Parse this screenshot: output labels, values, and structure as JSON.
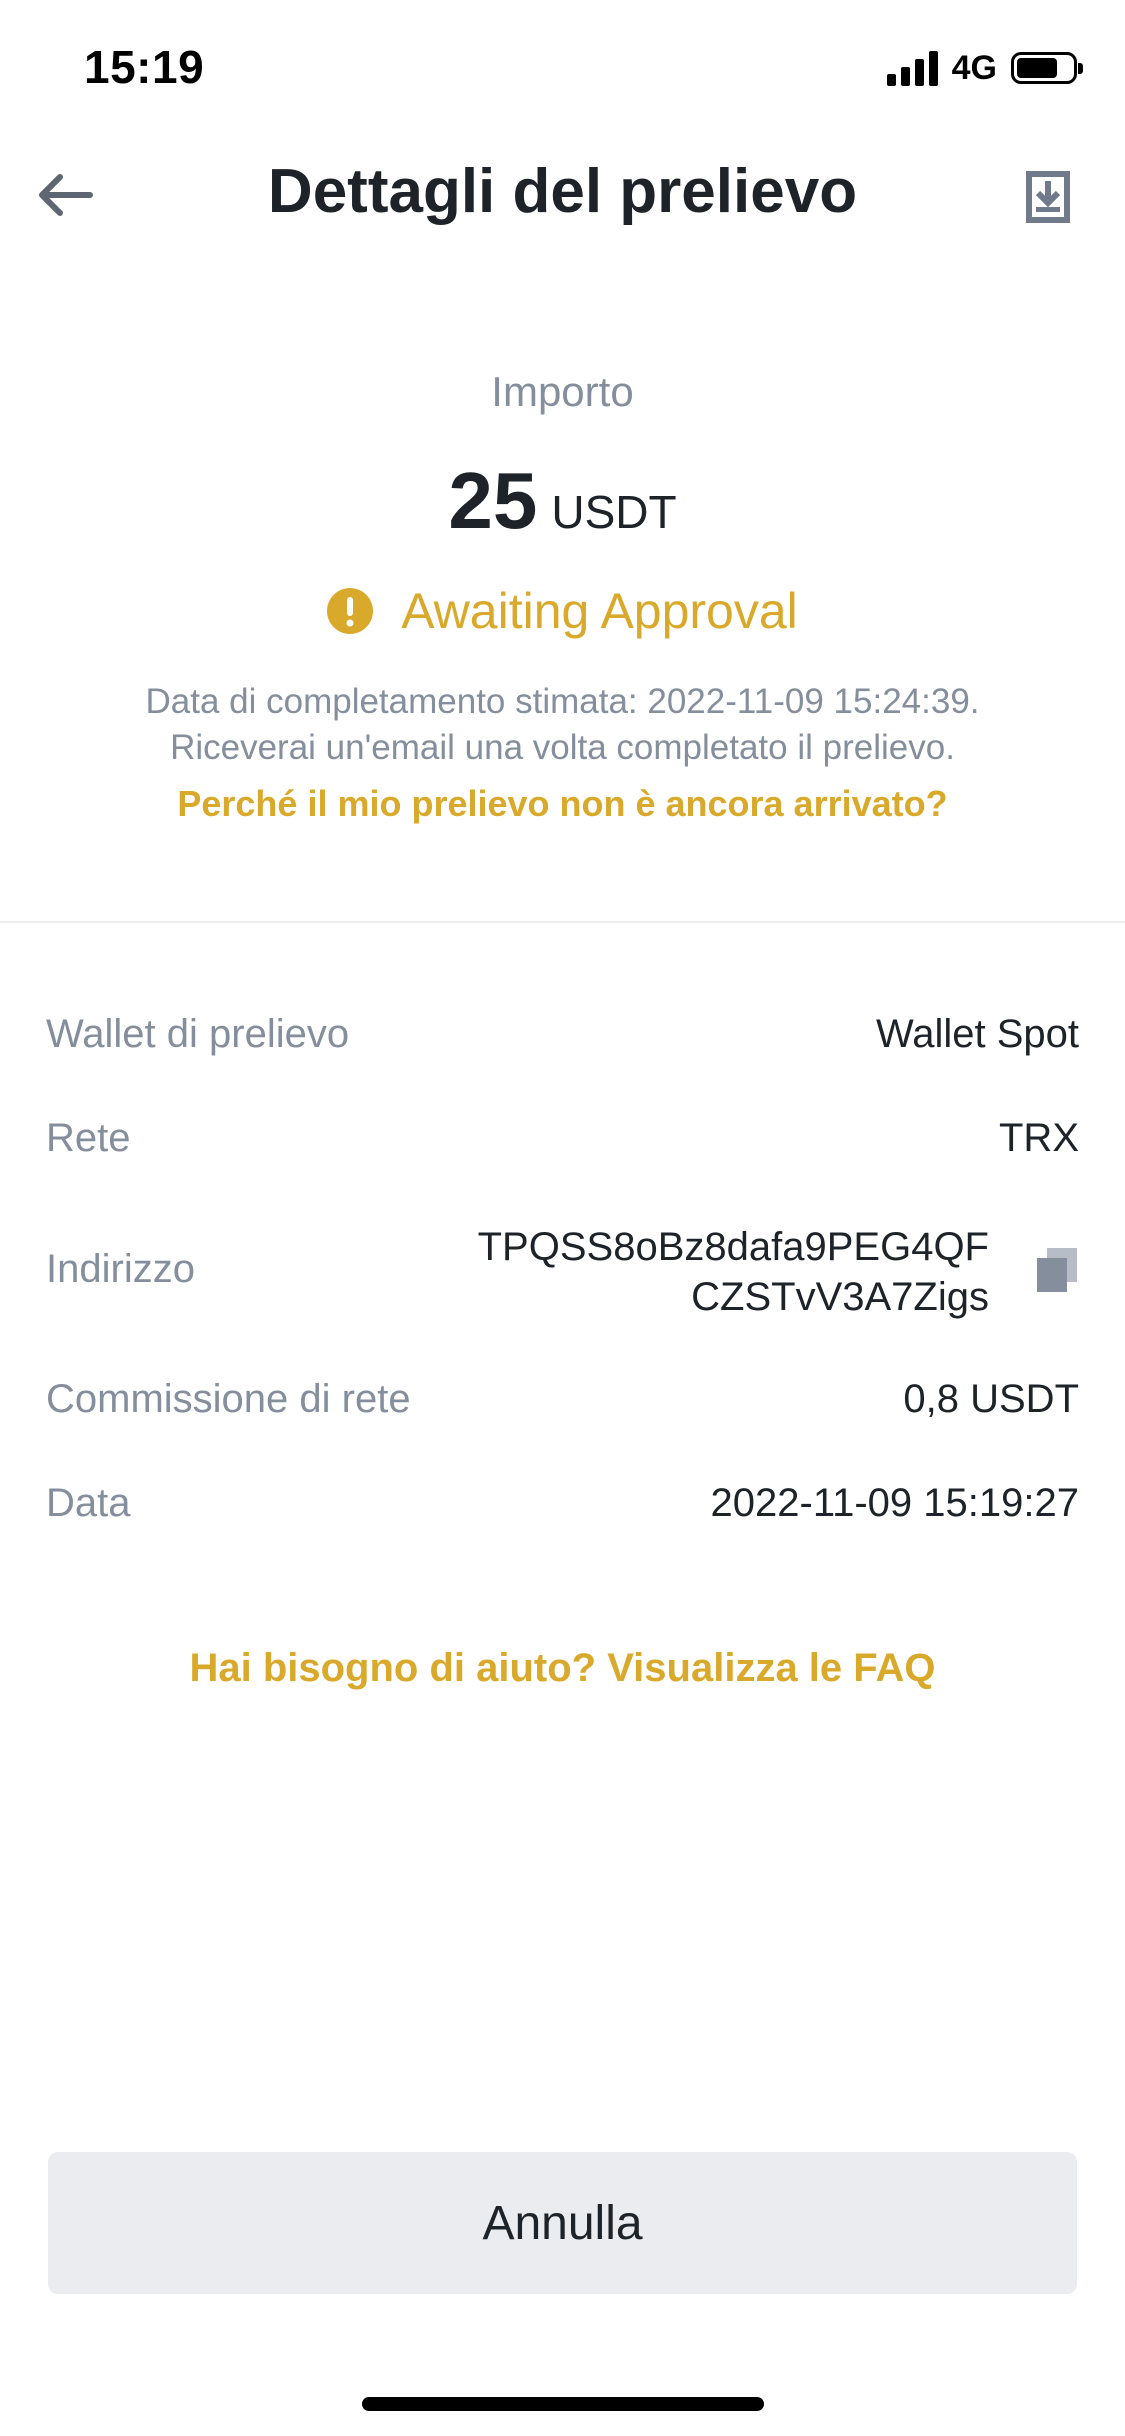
{
  "status_bar": {
    "time": "15:19",
    "network": "4G"
  },
  "header": {
    "title": "Dettagli del prelievo",
    "back_icon": "arrow-left-icon",
    "share_icon": "download-share-icon"
  },
  "amount": {
    "label": "Importo",
    "value": "25",
    "unit": "USDT",
    "status": "Awaiting Approval",
    "status_icon": "exclamation-circle-icon",
    "estimate_text": "Data di completamento stimata: 2022-11-09 15:24:39.",
    "email_text": "Riceverai un'email una volta completato il prelievo.",
    "why_link": "Perché il mio prelievo non è ancora arrivato?"
  },
  "details": {
    "wallet_label": "Wallet di prelievo",
    "wallet_value": "Wallet Spot",
    "network_label": "Rete",
    "network_value": "TRX",
    "address_label": "Indirizzo",
    "address_line1": "TPQSS8oBz8dafa9PEG4QF",
    "address_line2": "CZSTvV3A7Zigs",
    "fee_label": "Commissione di rete",
    "fee_value": "0,8 USDT",
    "date_label": "Data",
    "date_value": "2022-11-09 15:19:27"
  },
  "faq_link": "Hai bisogno di aiuto? Visualizza le FAQ",
  "cancel_button": "Annulla",
  "colors": {
    "accent": "#d9a92b",
    "muted": "#848e9c",
    "text": "#1e2329",
    "button_bg": "#eaecef"
  }
}
